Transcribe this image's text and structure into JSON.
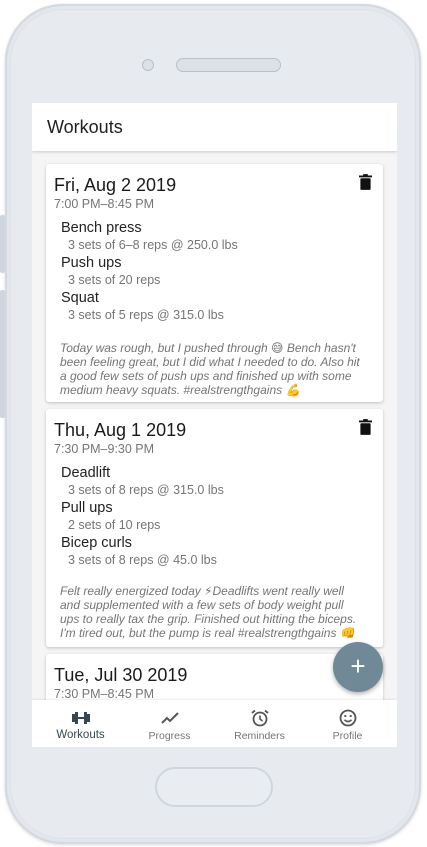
{
  "app": {
    "title": "Workouts"
  },
  "workouts": [
    {
      "date": "Fri, Aug 2 2019",
      "time": "7:00 PM–8:45 PM",
      "exercises": [
        {
          "name": "Bench press",
          "detail": "3 sets of 6–8 reps @ 250.0 lbs"
        },
        {
          "name": "Push ups",
          "detail": "3 sets of 20 reps"
        },
        {
          "name": "Squat",
          "detail": "3 sets of 5 reps @ 315.0 lbs"
        }
      ],
      "note_lines": [
        "Today was rough, but I pushed through 😅 Bench hasn't",
        "been feeling great, but I did what I needed to do. Also hit",
        "a good few sets of push ups and finished up with some",
        "medium heavy squats. #realstrengthgains 💪"
      ]
    },
    {
      "date": "Thu, Aug 1 2019",
      "time": "7:30 PM–9:30 PM",
      "exercises": [
        {
          "name": "Deadlift",
          "detail": "3 sets of 8 reps @ 315.0 lbs"
        },
        {
          "name": "Pull ups",
          "detail": "2 sets of 10 reps"
        },
        {
          "name": "Bicep curls",
          "detail": "3 sets of 8 reps @ 45.0 lbs"
        }
      ],
      "note_lines": [
        "Felt really energized today ⚡Deadlifts went really well",
        "and supplemented with a few sets of body weight pull",
        "ups to really tax the grip. Finished out hitting the biceps.",
        "I'm tired out, but the pump is real #realstrengthgains 👊"
      ]
    },
    {
      "date": "Tue, Jul 30 2019",
      "time": "7:30 PM–8:45 PM"
    }
  ],
  "fab": {
    "label": "+",
    "icon": "plus-icon"
  },
  "nav": [
    {
      "label": "Workouts",
      "icon": "dumbbell-icon",
      "active": true
    },
    {
      "label": "Progress",
      "icon": "trend-icon",
      "active": false
    },
    {
      "label": "Reminders",
      "icon": "alarm-icon",
      "active": false
    },
    {
      "label": "Profile",
      "icon": "smiley-icon",
      "active": false
    }
  ],
  "colors": {
    "accent": "#6f8996",
    "nav_active": "#37474f",
    "secondary_text": "#757575"
  }
}
